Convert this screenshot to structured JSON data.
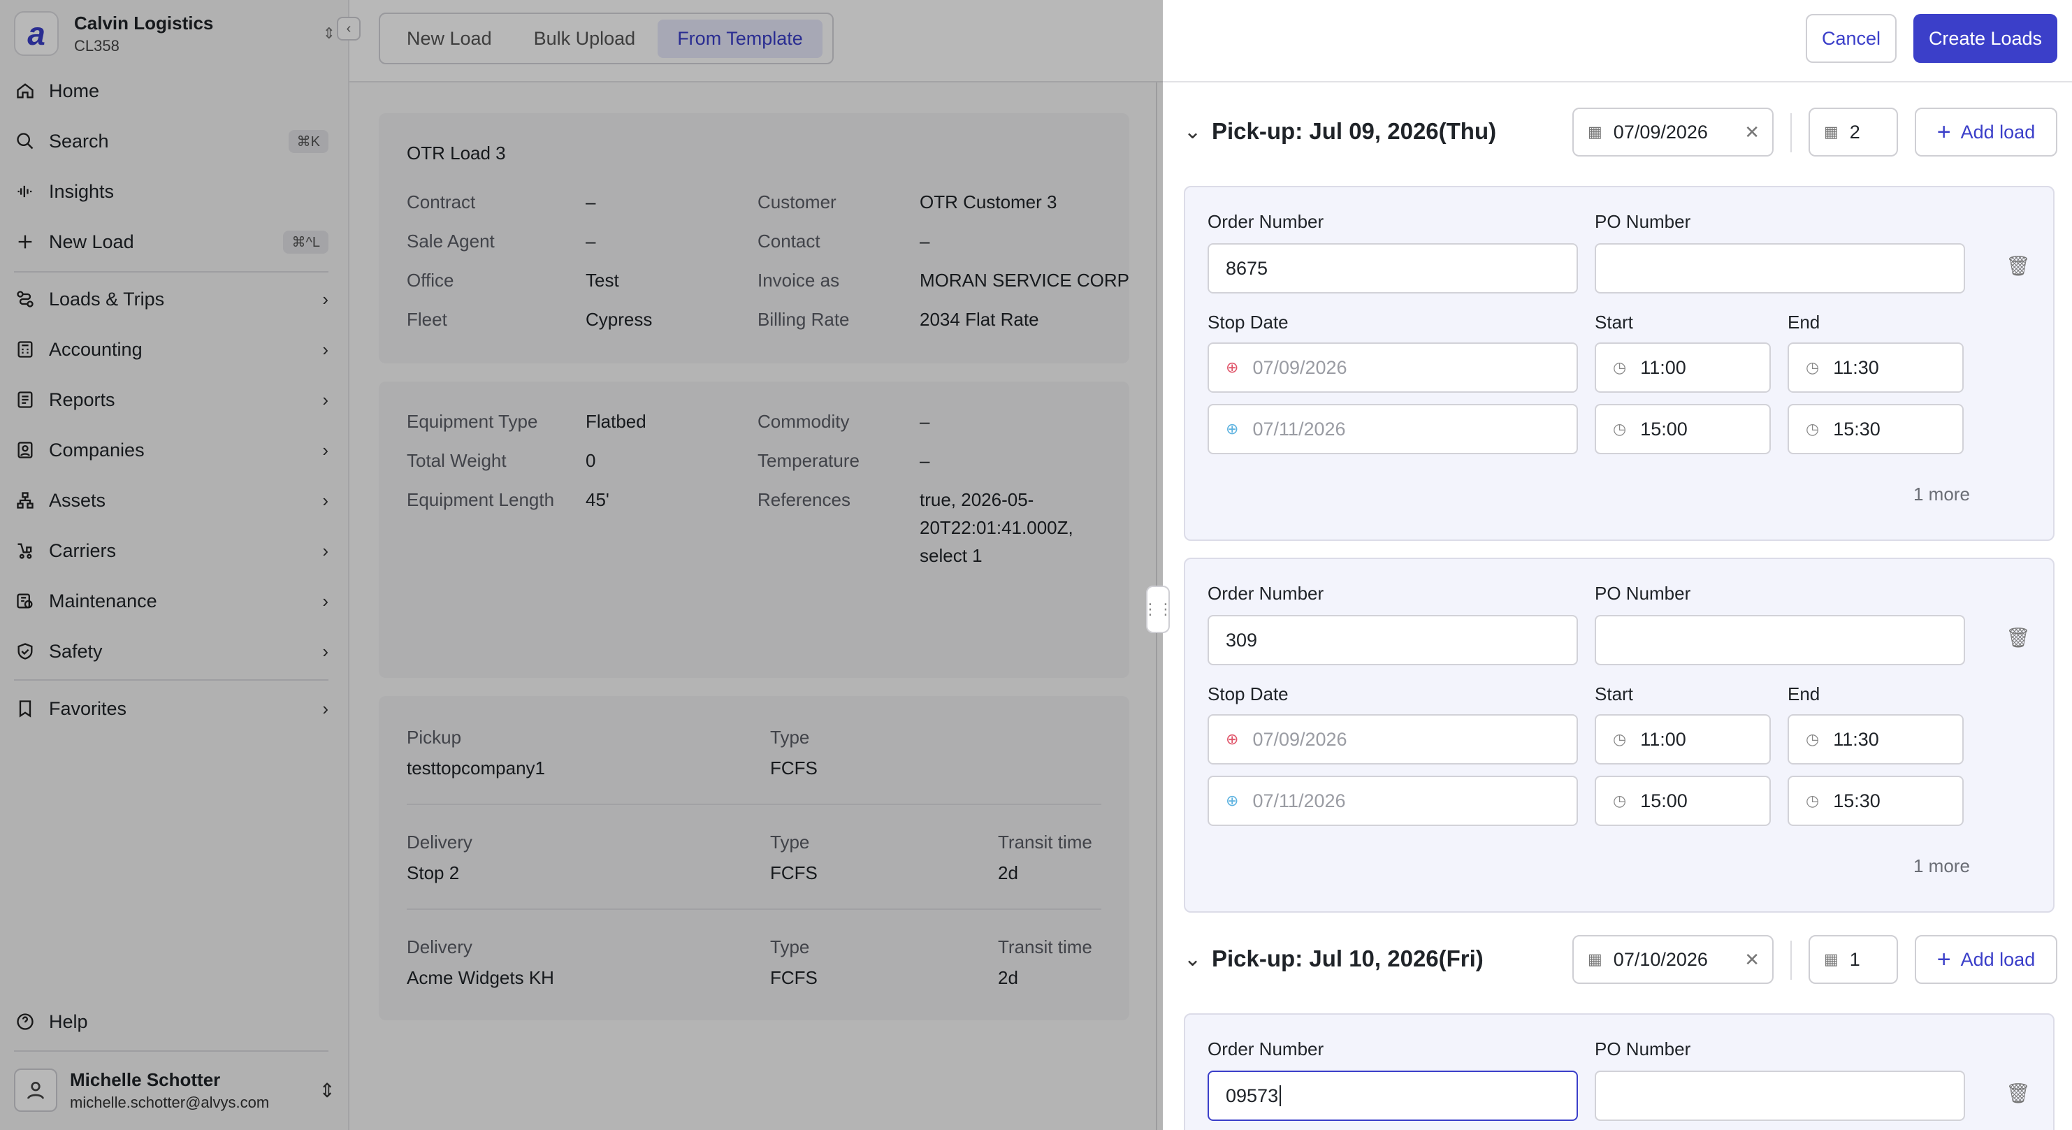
{
  "org": {
    "name": "Calvin Logistics",
    "code": "CL358",
    "logo": "a"
  },
  "nav": [
    {
      "label": "Home",
      "icon": "home-icon"
    },
    {
      "label": "Search",
      "icon": "search-icon",
      "kbd": "⌘K"
    },
    {
      "label": "Insights",
      "icon": "waveform-icon"
    },
    {
      "label": "New Load",
      "icon": "plus-icon",
      "kbd": "⌘^L"
    },
    {
      "label": "Loads & Trips",
      "icon": "route-icon"
    },
    {
      "label": "Accounting",
      "icon": "calculator-icon"
    },
    {
      "label": "Reports",
      "icon": "report-icon"
    },
    {
      "label": "Companies",
      "icon": "building-icon"
    },
    {
      "label": "Assets",
      "icon": "hierarchy-icon"
    },
    {
      "label": "Carriers",
      "icon": "forklift-icon"
    },
    {
      "label": "Maintenance",
      "icon": "wrench-icon"
    },
    {
      "label": "Safety",
      "icon": "shield-icon"
    },
    {
      "label": "Favorites",
      "icon": "bookmark-icon"
    }
  ],
  "help": "Help",
  "user": {
    "name": "Michelle Schotter",
    "email": "michelle.schotter@alvys.com"
  },
  "tabs": [
    "New Load",
    "Bulk Upload",
    "From Template"
  ],
  "actions": {
    "cancel": "Cancel",
    "create": "Create Loads"
  },
  "template": {
    "title": "OTR Load 3",
    "info": [
      {
        "label": "Contract",
        "value": "–",
        "label2": "Customer",
        "value2": "OTR Customer 3"
      },
      {
        "label": "Sale Agent",
        "value": "–",
        "label2": "Contact",
        "value2": "–"
      },
      {
        "label": "Office",
        "value": "Test",
        "label2": "Invoice as",
        "value2": "MORAN SERVICE CORP"
      },
      {
        "label": "Fleet",
        "value": "Cypress",
        "label2": "Billing Rate",
        "value2": "2034 Flat Rate"
      }
    ],
    "equipment": [
      {
        "label": "Equipment Type",
        "value": "Flatbed",
        "label2": "Commodity",
        "value2": "–"
      },
      {
        "label": "Total Weight",
        "value": "0",
        "label2": "Temperature",
        "value2": "–"
      },
      {
        "label": "Equipment Length",
        "value": "45'",
        "label2": "References",
        "value2": "true, 2026-05-"
      }
    ],
    "references_cont": [
      "20T22:01:41.000Z,",
      "select 1"
    ],
    "stops": [
      {
        "kind": "Pickup",
        "name": "testtopcompany1",
        "type_label": "Type",
        "type": "FCFS",
        "transit_label": "",
        "transit": ""
      },
      {
        "kind": "Delivery",
        "name": "Stop 2",
        "type_label": "Type",
        "type": "FCFS",
        "transit_label": "Transit time",
        "transit": "2d"
      },
      {
        "kind": "Delivery",
        "name": "Acme Widgets KH",
        "type_label": "Type",
        "type": "FCFS",
        "transit_label": "Transit time",
        "transit": "2d"
      }
    ]
  },
  "labels": {
    "order_number": "Order Number",
    "po_number": "PO Number",
    "stop_date": "Stop Date",
    "start": "Start",
    "end": "End",
    "add_load": "Add load",
    "more": "1 more"
  },
  "pickups": [
    {
      "title": "Pick-up: Jul 09, 2026(Thu)",
      "date": "07/09/2026",
      "count": "2",
      "loads": [
        {
          "order": "8675",
          "po": "",
          "pick_date": "07/09/2026",
          "pick_start": "11:00",
          "pick_end": "11:30",
          "drop_date": "07/11/2026",
          "drop_start": "15:00",
          "drop_end": "15:30"
        },
        {
          "order": "309",
          "po": "",
          "pick_date": "07/09/2026",
          "pick_start": "11:00",
          "pick_end": "11:30",
          "drop_date": "07/11/2026",
          "drop_start": "15:00",
          "drop_end": "15:30"
        }
      ]
    },
    {
      "title": "Pick-up: Jul 10, 2026(Fri)",
      "date": "07/10/2026",
      "count": "1",
      "loads": [
        {
          "order": "09573",
          "po": ""
        }
      ]
    }
  ],
  "colors": {
    "accent": "#3b3fc9",
    "pickup_icon": "#e0556a",
    "delivery_icon": "#5fb3e0"
  }
}
